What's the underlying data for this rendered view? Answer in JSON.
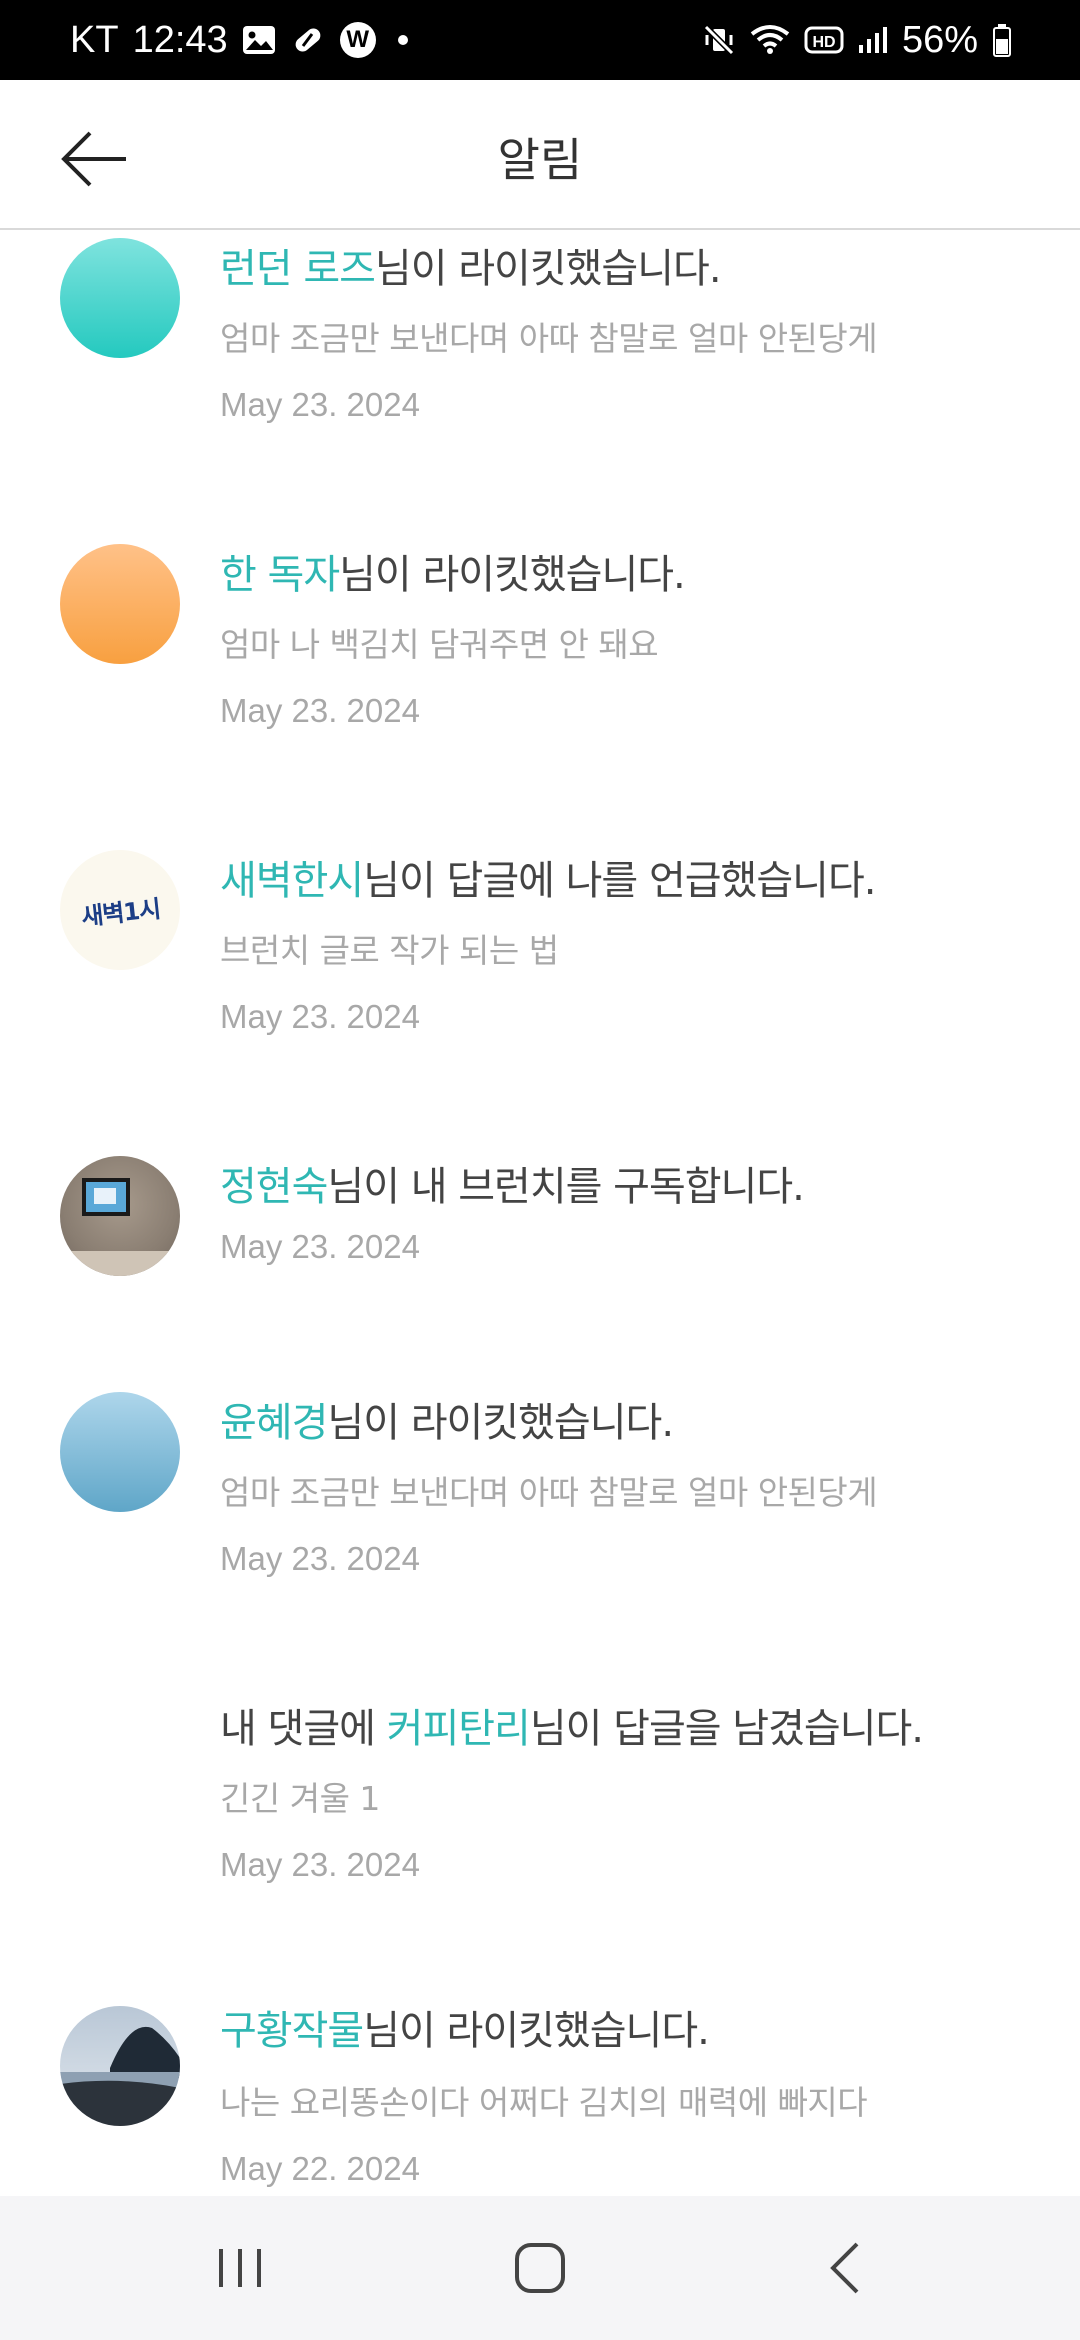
{
  "status_bar": {
    "carrier": "KT",
    "time": "12:43",
    "battery": "56%",
    "icons": [
      "image-icon",
      "pill-icon",
      "w-app-icon",
      "dot-icon",
      "mute-vibrate-icon",
      "wifi-icon",
      "hd-icon",
      "signal-icon",
      "battery-icon"
    ],
    "w_label": "W"
  },
  "header": {
    "title": "알림",
    "back_icon": "arrow-left-icon"
  },
  "colors": {
    "accent": "#2fb7b3",
    "text": "#444444",
    "muted": "#a8a8a8"
  },
  "notifications": [
    {
      "name": "런던 로즈",
      "pre": "",
      "post": "님이 라이킷했습니다.",
      "detail": "엄마 조금만 보낸다며 아따 참말로 얼마 안된당게",
      "date": "May 23. 2024",
      "avatar": "teal-gradient"
    },
    {
      "name": "한 독자",
      "pre": "",
      "post": "님이 라이킷했습니다.",
      "detail": "엄마 나 백김치 담궈주면 안 돼요",
      "date": "May 23. 2024",
      "avatar": "orange-gradient"
    },
    {
      "name": "새벽한시",
      "pre": "",
      "post": "님이 답글에 나를 언급했습니다.",
      "detail": "브런치 글로 작가 되는 법",
      "date": "May 23. 2024",
      "avatar": "text-logo",
      "avatar_text": "새벽1시"
    },
    {
      "name": "정현숙",
      "pre": "",
      "post": "님이 내 브런치를 구독합니다.",
      "detail": "",
      "date": "May 23. 2024",
      "avatar": "photo-tv"
    },
    {
      "name": "윤혜경",
      "pre": "",
      "post": "님이 라이킷했습니다.",
      "detail": "엄마 조금만 보낸다며 아따 참말로 얼마 안된당게",
      "date": "May 23. 2024",
      "avatar": "blue-gradient"
    },
    {
      "name": "커피탄리",
      "pre": "내 댓글에 ",
      "post": "님이 답글을 남겼습니다.",
      "detail": "긴긴 겨울 1",
      "date": "May 23. 2024",
      "avatar": "none"
    },
    {
      "name": "구황작물",
      "pre": "",
      "post": "님이 라이킷했습니다.",
      "detail": "나는 요리똥손이다 어쩌다 김치의 매력에 빠지다",
      "date": "May 22. 2024",
      "avatar": "photo-seaside"
    }
  ],
  "nav_bar": {
    "recents_icon": "recent-apps-icon",
    "home_icon": "home-icon",
    "back_icon": "back-chevron-icon"
  }
}
